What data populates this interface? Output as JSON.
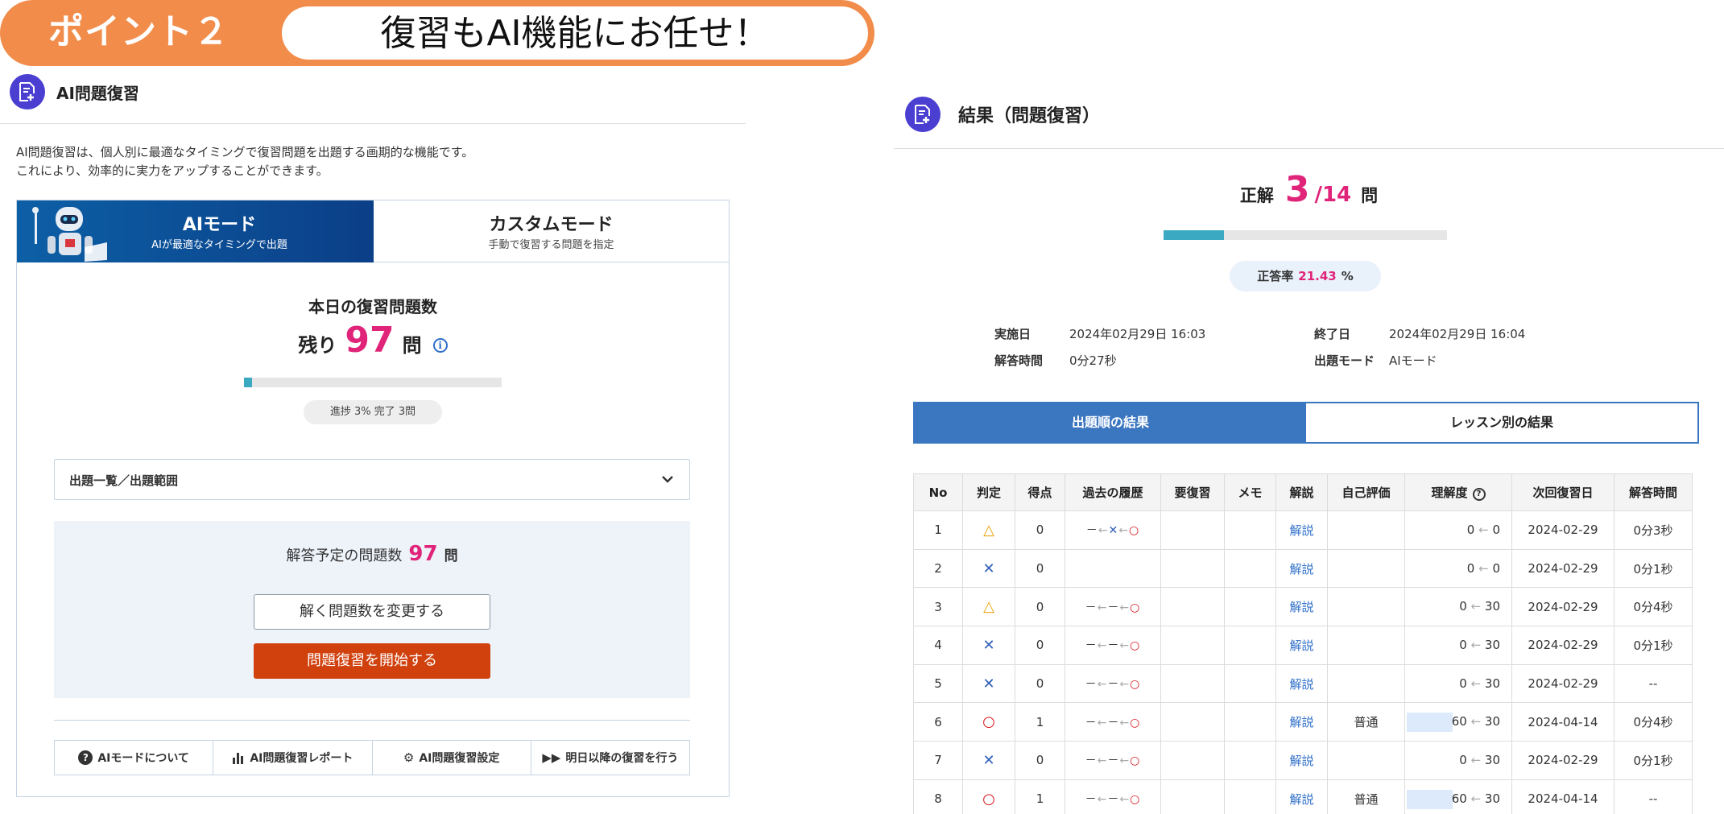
{
  "banner": {
    "point": "ポイント２",
    "title": "復習もAI機能にお任せ！"
  },
  "left": {
    "section_title": "AI問題復習",
    "intro": [
      "AI問題復習は、個人別に最適なタイミングで復習問題を出題する画期的な機能です。",
      "これにより、効率的に実力をアップすることができます。"
    ],
    "tabs": [
      {
        "label": "AIモード",
        "sub": "AIが最適なタイミングで出題",
        "active": true
      },
      {
        "label": "カスタムモード",
        "sub": "手動で復習する問題を指定",
        "active": false
      }
    ],
    "today_title": "本日の復習問題数",
    "remaining_label": "残り",
    "remaining_count": "97",
    "remaining_unit": "問",
    "progress_percent": 3,
    "progress_text": "進捗 3%  完了 3問",
    "range_label": "出題一覧／出題範囲",
    "plan_label": "解答予定の問題数",
    "plan_count": "97",
    "plan_unit": "問",
    "change_button": "解く問題数を変更する",
    "start_button": "問題復習を開始する",
    "footer_buttons": [
      {
        "label": "AIモードについて",
        "icon": "question-circle-icon"
      },
      {
        "label": "AI問題復習レポート",
        "icon": "bar-chart-icon"
      },
      {
        "label": "AI問題復習設定",
        "icon": "gear-icon"
      },
      {
        "label": "明日以降の復習を行う",
        "icon": "fast-forward-icon"
      }
    ]
  },
  "right": {
    "section_title": "結果（問題復習）",
    "score_label": "正解",
    "correct": "3",
    "slash": "/",
    "total": "14",
    "unit": "問",
    "progress_fraction": 0.2143,
    "rate_label": "正答率",
    "rate_value": "21.43",
    "rate_unit": "%",
    "meta": {
      "start_label": "実施日",
      "start_value": "2024年02月29日 16:03",
      "end_label": "終了日",
      "end_value": "2024年02月29日 16:04",
      "time_label": "解答時間",
      "time_value": "0分27秒",
      "mode_label": "出題モード",
      "mode_value": "AIモード"
    },
    "tabs": [
      {
        "label": "出題順の結果",
        "active": true
      },
      {
        "label": "レッスン別の結果",
        "active": false
      }
    ],
    "table": {
      "headers": [
        "No",
        "判定",
        "得点",
        "過去の履歴",
        "要復習",
        "メモ",
        "解説",
        "自己評価",
        "理解度",
        "次回復習日",
        "解答時間"
      ],
      "rows": [
        {
          "no": "1",
          "judge": "△",
          "score": "0",
          "history": [
            "－",
            "✕",
            "○"
          ],
          "review": "",
          "memo": "",
          "kaisetsu": "解説",
          "self": "",
          "und_new": "0",
          "und_old": "0",
          "und_level": 0,
          "next": "2024-02-29",
          "time": "0分3秒"
        },
        {
          "no": "2",
          "judge": "✕",
          "score": "0",
          "history": [],
          "review": "",
          "memo": "",
          "kaisetsu": "解説",
          "self": "",
          "und_new": "0",
          "und_old": "0",
          "und_level": 0,
          "next": "2024-02-29",
          "time": "0分1秒"
        },
        {
          "no": "3",
          "judge": "△",
          "score": "0",
          "history": [
            "－",
            "－",
            "○"
          ],
          "review": "",
          "memo": "",
          "kaisetsu": "解説",
          "self": "",
          "und_new": "0",
          "und_old": "30",
          "und_level": 0,
          "next": "2024-02-29",
          "time": "0分4秒"
        },
        {
          "no": "4",
          "judge": "✕",
          "score": "0",
          "history": [
            "－",
            "－",
            "○"
          ],
          "review": "",
          "memo": "",
          "kaisetsu": "解説",
          "self": "",
          "und_new": "0",
          "und_old": "30",
          "und_level": 0,
          "next": "2024-02-29",
          "time": "0分1秒"
        },
        {
          "no": "5",
          "judge": "✕",
          "score": "0",
          "history": [
            "－",
            "－",
            "○"
          ],
          "review": "",
          "memo": "",
          "kaisetsu": "解説",
          "self": "",
          "und_new": "0",
          "und_old": "30",
          "und_level": 0,
          "next": "2024-02-29",
          "time": "--"
        },
        {
          "no": "6",
          "judge": "○",
          "score": "1",
          "history": [
            "－",
            "－",
            "○"
          ],
          "review": "",
          "memo": "",
          "kaisetsu": "解説",
          "self": "普通",
          "und_new": "60",
          "und_old": "30",
          "und_level": 60,
          "next": "2024-04-14",
          "time": "0分4秒"
        },
        {
          "no": "7",
          "judge": "✕",
          "score": "0",
          "history": [
            "－",
            "－",
            "○"
          ],
          "review": "",
          "memo": "",
          "kaisetsu": "解説",
          "self": "",
          "und_new": "0",
          "und_old": "30",
          "und_level": 0,
          "next": "2024-02-29",
          "time": "0分1秒"
        },
        {
          "no": "8",
          "judge": "○",
          "score": "1",
          "history": [
            "－",
            "－",
            "○"
          ],
          "review": "",
          "memo": "",
          "kaisetsu": "解説",
          "self": "普通",
          "und_new": "60",
          "und_old": "30",
          "und_level": 60,
          "next": "2024-04-14",
          "time": "--"
        }
      ]
    }
  },
  "colors": {
    "accent_pink": "#e0247a",
    "banner_orange": "#f28c4a",
    "primary_blue": "#3b76c0",
    "start_red": "#d0410e",
    "progress_teal": "#3aa9c1"
  }
}
